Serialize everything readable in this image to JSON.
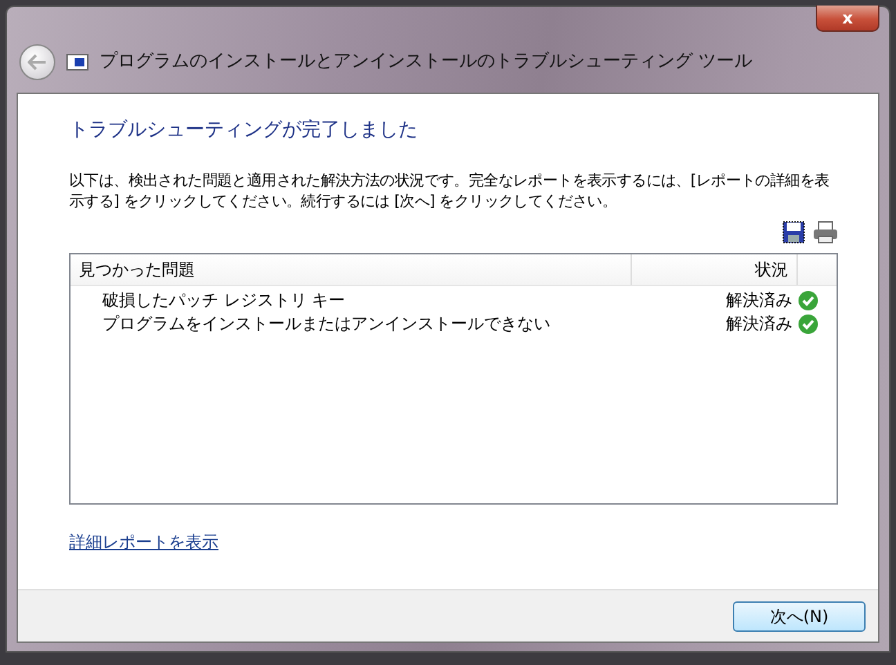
{
  "window": {
    "title": "プログラムのインストールとアンインストールのトラブルシューティング ツール",
    "close": "x"
  },
  "heading": "トラブルシューティングが完了しました",
  "description": "以下は、検出された問題と適用された解決方法の状況です。完全なレポートを表示するには、[レポートの詳細を表示する] をクリックしてください。続行するには [次へ] をクリックしてください。",
  "table": {
    "columns": [
      "見つかった問題",
      "状況"
    ],
    "rows": [
      {
        "problem": "破損したパッチ レジストリ キー",
        "status": "解決済み",
        "resolved": true
      },
      {
        "problem": "プログラムをインストールまたはアンインストールできない",
        "status": "解決済み",
        "resolved": true
      }
    ]
  },
  "details_link": "詳細レポートを表示",
  "buttons": [
    "次へ(N)"
  ]
}
